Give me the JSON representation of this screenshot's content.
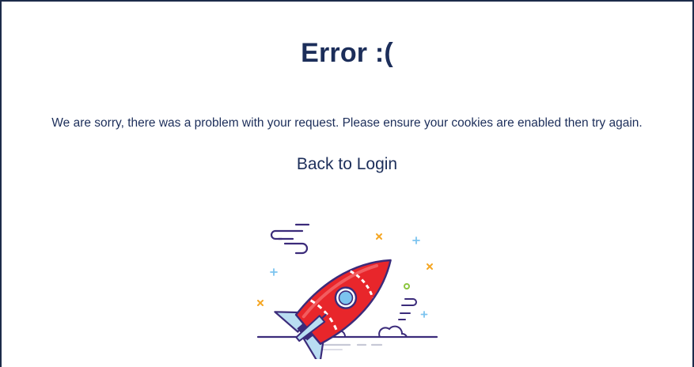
{
  "error_page": {
    "title": "Error :(",
    "message": "We are sorry, there was a problem with your request. Please ensure your cookies are enabled then try again.",
    "back_link_label": "Back to Login",
    "illustration": "crashed-rocket-illustration"
  },
  "colors": {
    "text": "#1c2e5a",
    "rocket_body": "#e8262b",
    "rocket_fin": "#b9ddf2",
    "outline": "#3b2b7a",
    "accent_orange": "#f5a623",
    "accent_green": "#8cc63f",
    "accent_blue": "#7cc4ef"
  }
}
